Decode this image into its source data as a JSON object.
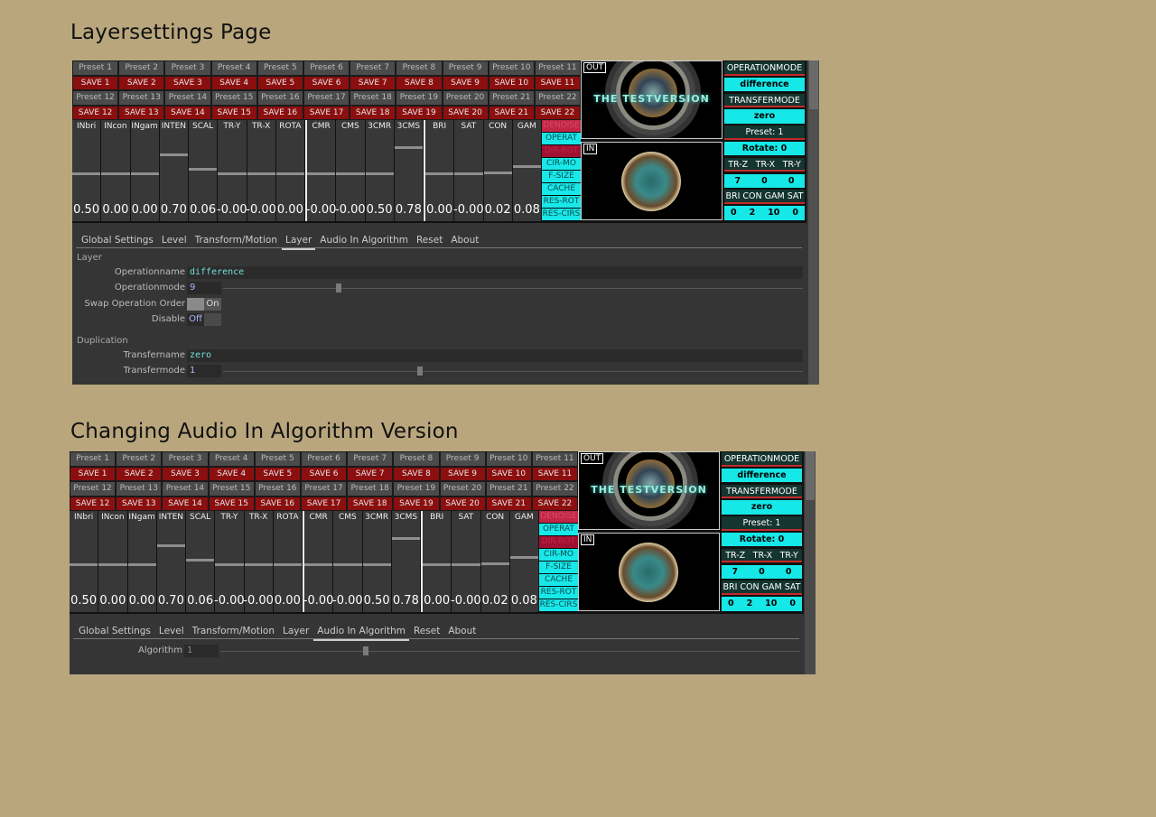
{
  "sections": [
    {
      "heading": "Layersettings Page",
      "active_tab": 4
    },
    {
      "heading": "Changing Audio In Algorithm Version",
      "active_tab": 5
    }
  ],
  "presets_row1": [
    "Preset 1",
    "Preset 2",
    "Preset 3",
    "Preset 4",
    "Preset 5",
    "Preset 6",
    "Preset 7",
    "Preset 8",
    "Preset 9",
    "Preset 10",
    "Preset 11"
  ],
  "saves_row1": [
    "SAVE 1",
    "SAVE 2",
    "SAVE 3",
    "SAVE 4",
    "SAVE 5",
    "SAVE 6",
    "SAVE 7",
    "SAVE 8",
    "SAVE 9",
    "SAVE 10",
    "SAVE 11"
  ],
  "presets_row2": [
    "Preset 12",
    "Preset 13",
    "Preset 14",
    "Preset 15",
    "Preset 16",
    "Preset 17",
    "Preset 18",
    "Preset 19",
    "Preset 20",
    "Preset 21",
    "Preset 22"
  ],
  "saves_row2": [
    "SAVE 12",
    "SAVE 13",
    "SAVE 14",
    "SAVE 15",
    "SAVE 16",
    "SAVE 17",
    "SAVE 18",
    "SAVE 19",
    "SAVE 20",
    "SAVE 21",
    "SAVE 22"
  ],
  "faders": [
    {
      "label": "INbri",
      "value": "0.50",
      "level": 0.5
    },
    {
      "label": "INcon",
      "value": "0.00",
      "level": 0.5
    },
    {
      "label": "INgam",
      "value": "0.00",
      "level": 0.5
    },
    {
      "label": "INTEN",
      "value": "0.70",
      "level": 0.7
    },
    {
      "label": "SCAL",
      "value": "0.06",
      "level": 0.55
    },
    {
      "label": "TR-Y",
      "value": "-0.00",
      "level": 0.5
    },
    {
      "label": "TR-X",
      "value": "-0.00",
      "level": 0.5
    },
    {
      "label": "ROTA",
      "value": "0.00",
      "level": 0.5
    },
    {
      "label": "CMR",
      "value": "-0.00",
      "level": 0.5
    },
    {
      "label": "CMS",
      "value": "-0.00",
      "level": 0.5
    },
    {
      "label": "3CMR",
      "value": "0.50",
      "level": 0.5
    },
    {
      "label": "3CMS",
      "value": "0.78",
      "level": 0.78
    },
    {
      "label": "BRI",
      "value": "0.00",
      "level": 0.5
    },
    {
      "label": "SAT",
      "value": "-0.00",
      "level": 0.5
    },
    {
      "label": "CON",
      "value": "0.02",
      "level": 0.51
    },
    {
      "label": "GAM",
      "value": "0.08",
      "level": 0.58
    }
  ],
  "modes": [
    {
      "label": "DENOISE",
      "style": "red"
    },
    {
      "label": "OPERAT",
      "style": "cyan"
    },
    {
      "label": "DIR-ROT",
      "style": "dark"
    },
    {
      "label": "CIR-MO",
      "style": "cyan"
    },
    {
      "label": "F-SIZE",
      "style": "cyan"
    },
    {
      "label": "CACHE",
      "style": "cyan"
    },
    {
      "label": "RES-ROT",
      "style": "cyan"
    },
    {
      "label": "RES-CIRS",
      "style": "cyan"
    }
  ],
  "video": {
    "out_label": "OUT",
    "in_label": "IN",
    "banner": "THE TESTVERSION"
  },
  "info": {
    "operationmode_label": "OPERATIONMODE",
    "operationmode_value": "difference",
    "transfermode_label": "TRANSFERMODE",
    "transfermode_value": "zero",
    "preset": "Preset: 1",
    "rotate": "Rotate: 0",
    "tr_labels": [
      "TR-Z",
      "TR-X",
      "TR-Y"
    ],
    "tr_values": [
      "7",
      "0",
      "0"
    ],
    "color_labels": [
      "BRI",
      "CON",
      "GAM",
      "SAT"
    ],
    "color_values": [
      "0",
      "2",
      "10",
      "0"
    ]
  },
  "tabs": [
    "Global Settings",
    "Level",
    "Transform/Motion",
    "Layer",
    "Audio In Algorithm",
    "Reset",
    "About"
  ],
  "layer_panel": {
    "layer_title": "Layer",
    "operationname_label": "Operationname",
    "operationname_value": "difference",
    "operationmode_label": "Operationmode",
    "operationmode_value": "9",
    "operationmode_level": 0.2,
    "swap_label": "Swap Operation Order",
    "swap_value": "On",
    "disable_label": "Disable",
    "disable_value": "Off",
    "duplication_title": "Duplication",
    "transfername_label": "Transfername",
    "transfername_value": "zero",
    "transfermode_label": "Transfermode",
    "transfermode_value": "1",
    "transfermode_level": 0.34
  },
  "audio_panel": {
    "algorithm_label": "Algorithm",
    "algorithm_value": "1",
    "algorithm_level": 0.25
  }
}
